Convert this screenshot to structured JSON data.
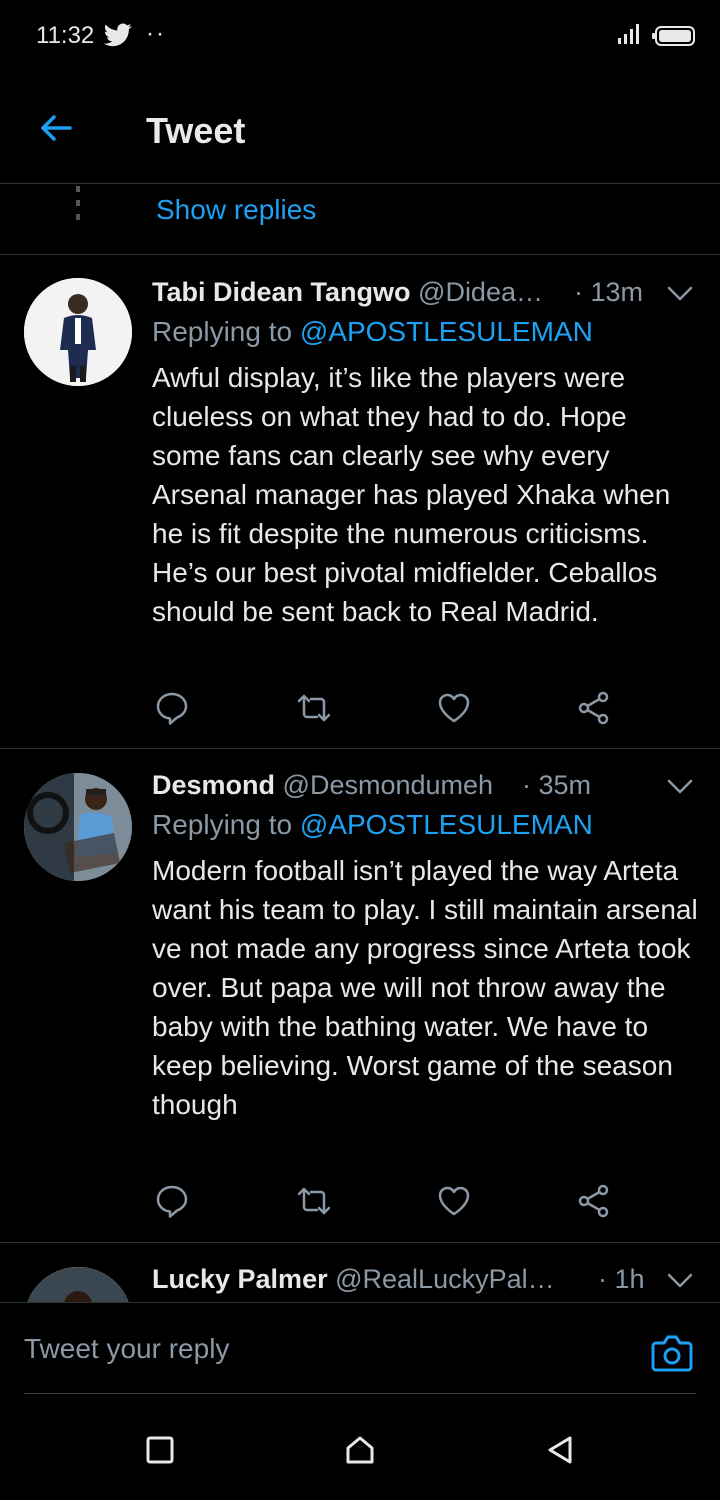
{
  "status_bar": {
    "time": "11:32"
  },
  "header": {
    "title": "Tweet"
  },
  "thread": {
    "show_replies_label": "Show replies"
  },
  "tweets": [
    {
      "name": "Tabi Didean Tangwo",
      "handle": "@Didea…",
      "time": "· 13m",
      "replying_prefix": "Replying to",
      "replying_to": "@APOSTLESULEMAN",
      "text": "Awful display, it’s like the players were clueless on what they had to do. Hope some fans can clearly see why every Arsenal manager has played Xhaka when he is fit despite the numerous criticisms. He’s our best pivotal midfielder. Ceballos should be sent back to Real Madrid."
    },
    {
      "name": "Desmond",
      "handle": "@Desmondumeh",
      "time": "· 35m",
      "replying_prefix": "Replying to",
      "replying_to": "@APOSTLESULEMAN",
      "text": "Modern football isn’t played the way Arteta want his team to play. I still maintain arsenal ve not made any progress since Arteta took over. But papa we will not throw away the baby with the bathing water. We have to keep believing. Worst game of the season though"
    },
    {
      "name": "Lucky Palmer",
      "handle": "@RealLuckyPal…",
      "time": "· 1h"
    }
  ],
  "reply_bar": {
    "placeholder": "Tweet your reply"
  },
  "colors": {
    "accent": "#1da1f2",
    "muted": "#8b98a5",
    "text": "#e8e8e8",
    "background": "#000000",
    "divider": "#2f3336"
  }
}
